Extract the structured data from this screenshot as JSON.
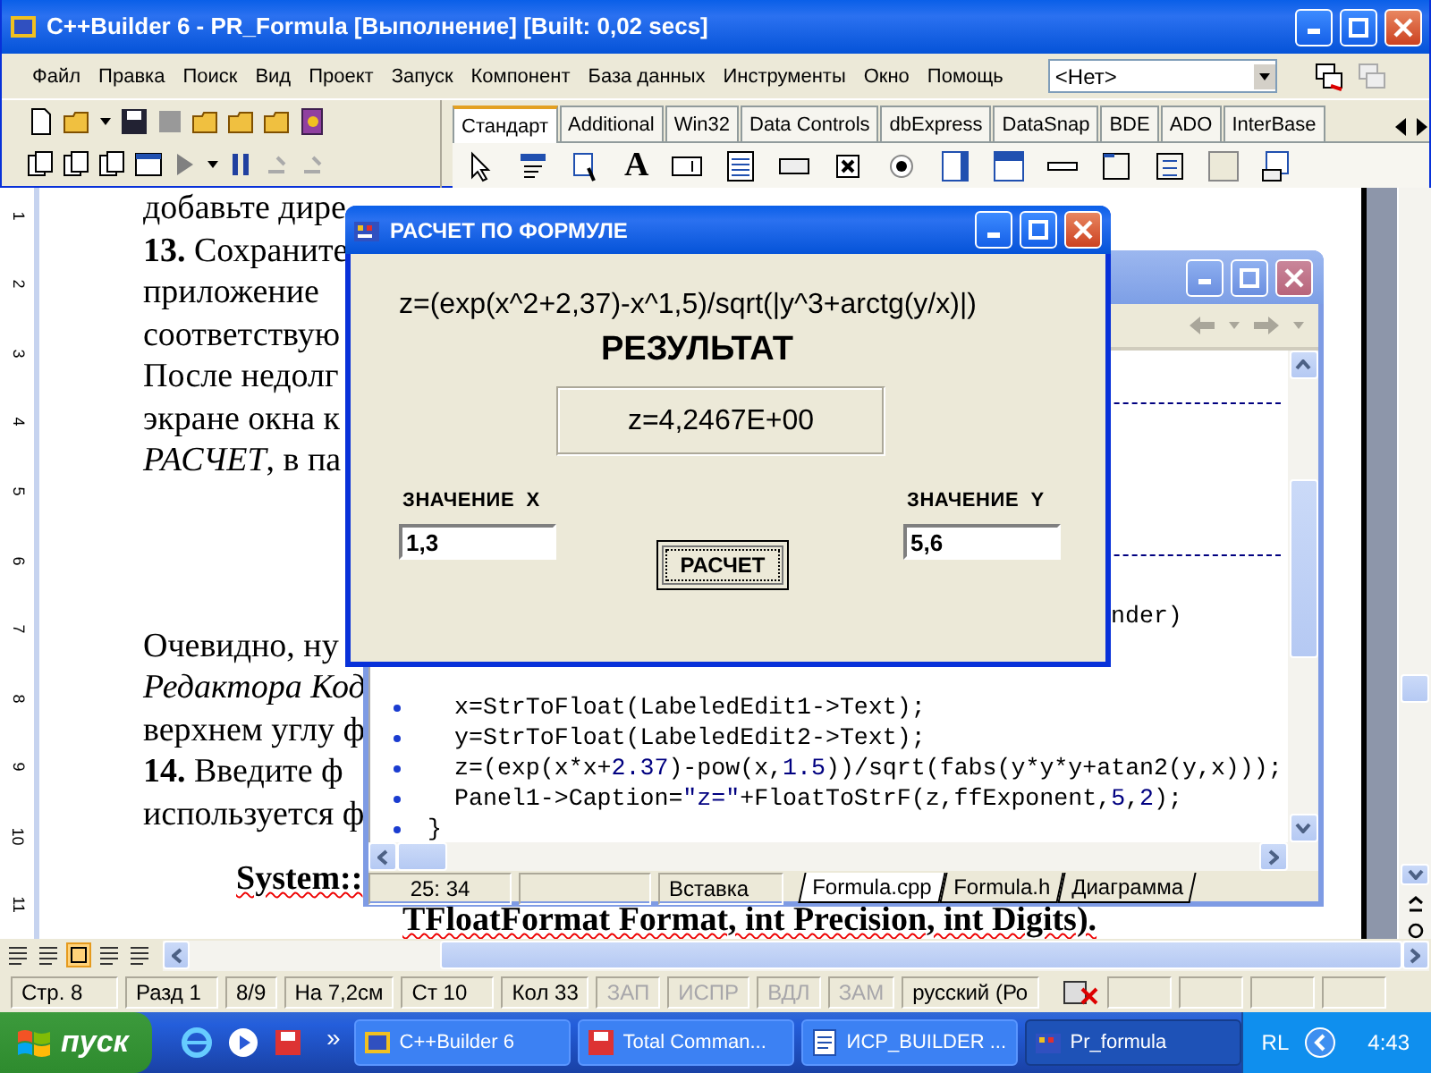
{
  "ide": {
    "title": "C++Builder 6 - PR_Formula [Выполнение] [Built: 0,02 secs]",
    "menu": [
      "Файл",
      "Правка",
      "Поиск",
      "Вид",
      "Проект",
      "Запуск",
      "Компонент",
      "База данных",
      "Инструменты",
      "Окно",
      "Помощь"
    ],
    "combo": "<Нет>",
    "palette_tabs": [
      {
        "label": "Стандарт",
        "selected": true
      },
      {
        "label": "Additional",
        "selected": false
      },
      {
        "label": "Win32",
        "selected": false
      },
      {
        "label": "Data Controls",
        "selected": false
      },
      {
        "label": "dbExpress",
        "selected": false
      },
      {
        "label": "DataSnap",
        "selected": false
      },
      {
        "label": "BDE",
        "selected": false
      },
      {
        "label": "ADO",
        "selected": false
      },
      {
        "label": "InterBase",
        "selected": false
      }
    ],
    "palette_glyph": "A"
  },
  "document": {
    "ruler": [
      "1",
      "2",
      "3",
      "4",
      "5",
      "6",
      "7",
      "8",
      "9",
      "10",
      "11"
    ],
    "paragraphs": [
      [
        {
          "text": "добавьте дире",
          "italic": false
        },
        {
          "text": "**13.** Сохраните",
          "italic": false
        },
        {
          "text": "приложение",
          "italic": false
        },
        {
          "text": "соответствую",
          "italic": false
        },
        {
          "text": "После недолг",
          "italic": false
        },
        {
          "text": "экране  окна  к",
          "italic": false
        },
        {
          "text": "*РАСЧЕТ*, в па",
          "italic": false
        }
      ],
      [
        {
          "text": "Очевидно, ну",
          "italic": false
        },
        {
          "text": "Редактора Код",
          "italic": true
        },
        {
          "text": "верхнем углу ф",
          "italic": false
        },
        {
          "text": "**14.** Введите  ф",
          "italic": false
        },
        {
          "text": "используется ф",
          "italic": false
        }
      ]
    ],
    "signature": [
      {
        "text": "System::",
        "spell_error": true
      },
      {
        "text": "TFloatFormat Format, int Precision, int Digits).",
        "spell_error": true
      }
    ]
  },
  "editor": {
    "code_lines": [
      {
        "kind": "blank"
      },
      {
        "kind": "rule"
      },
      {
        "kind": "blank"
      },
      {
        "kind": "blank"
      },
      {
        "kind": "blank"
      },
      {
        "kind": "blank"
      },
      {
        "kind": "rule"
      },
      {
        "kind": "blank"
      },
      {
        "kind": "tail",
        "tokens": [
          {
            "text": "nder)",
            "kind": "plain"
          }
        ]
      },
      {
        "kind": "blank"
      },
      {
        "kind": "blank"
      },
      {
        "kind": "statement",
        "tokens": [
          {
            "text": "x=StrToFloat(LabeledEdit1->Text);",
            "kind": "plain"
          }
        ]
      },
      {
        "kind": "statement",
        "tokens": [
          {
            "text": "y=StrToFloat(LabeledEdit2->Text);",
            "kind": "plain"
          }
        ]
      },
      {
        "kind": "statement",
        "tokens": [
          {
            "text": "z=(exp(x*x+",
            "kind": "plain"
          },
          {
            "text": "2.37",
            "kind": "literal"
          },
          {
            "text": ")-pow(x,",
            "kind": "plain"
          },
          {
            "text": "1.5",
            "kind": "literal"
          },
          {
            "text": "))/sqrt(fabs(y*y*y+atan2(y,x)));",
            "kind": "plain"
          }
        ]
      },
      {
        "kind": "statement",
        "tokens": [
          {
            "text": "Panel1->Caption=",
            "kind": "plain"
          },
          {
            "text": "\"z=\"",
            "kind": "literal"
          },
          {
            "text": "+FloatToStrF(z,ffExponent,",
            "kind": "plain"
          },
          {
            "text": "5",
            "kind": "literal"
          },
          {
            "text": ",",
            "kind": "plain"
          },
          {
            "text": "2",
            "kind": "literal"
          },
          {
            "text": ");",
            "kind": "plain"
          }
        ]
      },
      {
        "kind": "block_end",
        "tokens": [
          {
            "text": "}",
            "kind": "plain"
          }
        ]
      }
    ],
    "position": "25:  34",
    "mode": "Вставка",
    "tabs": [
      {
        "label": "Formula.cpp",
        "selected": true
      },
      {
        "label": "Formula.h",
        "selected": false
      },
      {
        "label": "Диаграмма",
        "selected": false
      }
    ]
  },
  "dialog": {
    "title": "РАСЧЕТ ПО ФОРМУЛЕ",
    "formula": "z=(exp(x^2+2,37)-x^1,5)/sqrt(|y^3+arctg(y/x)|)",
    "heading": "РЕЗУЛЬТАТ",
    "result": "z=4,2467E+00",
    "x_label": "ЗНАЧЕНИЕ  X",
    "x_value": "1,3",
    "y_label": "ЗНАЧЕНИЕ  Y",
    "y_value": "5,6",
    "button": "РАСЧЕТ"
  },
  "word_status": [
    {
      "text": "Стр. 8",
      "disabled": false
    },
    {
      "text": "Разд 1",
      "disabled": false
    },
    {
      "text": "8/9",
      "disabled": false
    },
    {
      "text": "На 7,2см",
      "disabled": false
    },
    {
      "text": "Ст 10",
      "disabled": false
    },
    {
      "text": "Кол 33",
      "disabled": false
    },
    {
      "text": "ЗАП",
      "disabled": true
    },
    {
      "text": "ИСПР",
      "disabled": true
    },
    {
      "text": "ВДЛ",
      "disabled": true
    },
    {
      "text": "ЗАМ",
      "disabled": true
    },
    {
      "text": "русский (Ро",
      "disabled": false
    }
  ],
  "taskbar": {
    "start": "пуск",
    "more": "»",
    "tasks": [
      {
        "label": "C++Builder 6",
        "selected": false
      },
      {
        "label": "Total Comman...",
        "selected": false
      },
      {
        "label": "ИСР_BUILDER ...",
        "selected": false
      },
      {
        "label": "Pr_formula",
        "selected": true
      }
    ],
    "tray_lang": "RL",
    "clock": "4:43"
  }
}
